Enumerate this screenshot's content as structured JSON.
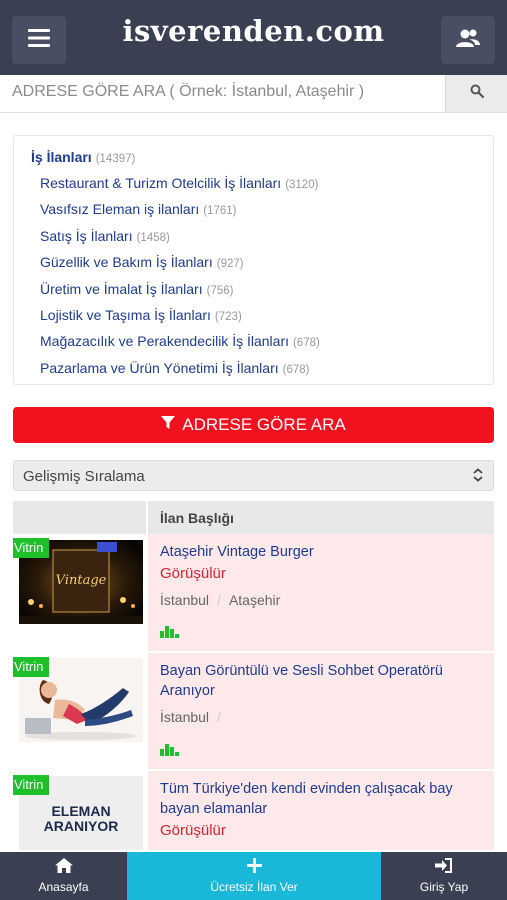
{
  "header": {
    "logo": "isverenden.com",
    "menu_icon": "hamburger-menu-icon",
    "user_icon": "users-icon"
  },
  "search": {
    "placeholder": "ADRESE GÖRE ARA ( Örnek: İstanbul, Ataşehir )",
    "icon": "search-icon"
  },
  "categories": {
    "root": {
      "label": "İş İlanları",
      "count": "(14397)"
    },
    "items": [
      {
        "label": "Restaurant & Turizm Otelcilik İş İlanları",
        "count": "(3120)"
      },
      {
        "label": "Vasıfsız Eleman iş ilanları",
        "count": "(1761)"
      },
      {
        "label": "Satış İş İlanları",
        "count": "(1458)"
      },
      {
        "label": "Güzellik ve Bakım İş İlanları",
        "count": "(927)"
      },
      {
        "label": "Üretim ve İmalat İş İlanları",
        "count": "(756)"
      },
      {
        "label": "Lojistik ve Taşıma İş İlanları",
        "count": "(723)"
      },
      {
        "label": "Mağazacılık ve Perakendecilik İş İlanları",
        "count": "(678)"
      },
      {
        "label": "Pazarlama ve Ürün Yönetimi İş İlanları",
        "count": "(678)"
      }
    ]
  },
  "filter_button": {
    "label": "ADRESE GÖRE ARA",
    "icon": "filter-icon"
  },
  "sort": {
    "selected": "Gelişmiş Sıralama",
    "icon": "up-down-chevron-icon"
  },
  "table": {
    "header_title": "İlan Başlığı",
    "listings": [
      {
        "badge": "Vitrin",
        "title": "Ataşehir Vintage Burger",
        "price": "Görüşülür",
        "city": "İstanbul",
        "district": "Ataşehir",
        "stat_icon": "bar-chart-icon"
      },
      {
        "badge": "Vitrin",
        "title": "Bayan Görüntülü ve Sesli Sohbet Operatörü Aranıyor",
        "city": "İstanbul",
        "district": "",
        "stat_icon": "bar-chart-icon"
      },
      {
        "badge": "Vitrin",
        "thumb_text_1": "ELEMAN",
        "thumb_text_2": "ARANIYOR",
        "title": "Tüm Türkiye'den kendi evinden çalışacak bay bayan elamanlar",
        "price": "Görüşülür"
      }
    ]
  },
  "bottom_nav": {
    "home": "Anasayfa",
    "post": "Ücretsiz İlan Ver",
    "login": "Giriş Yap"
  },
  "colors": {
    "header_bg": "#3b3f52",
    "accent_red": "#f2121f",
    "accent_cyan": "#19b8d8",
    "badge_green": "#1fbf2a",
    "link_blue": "#1f3b8f",
    "row_pink": "#fde8ea"
  }
}
